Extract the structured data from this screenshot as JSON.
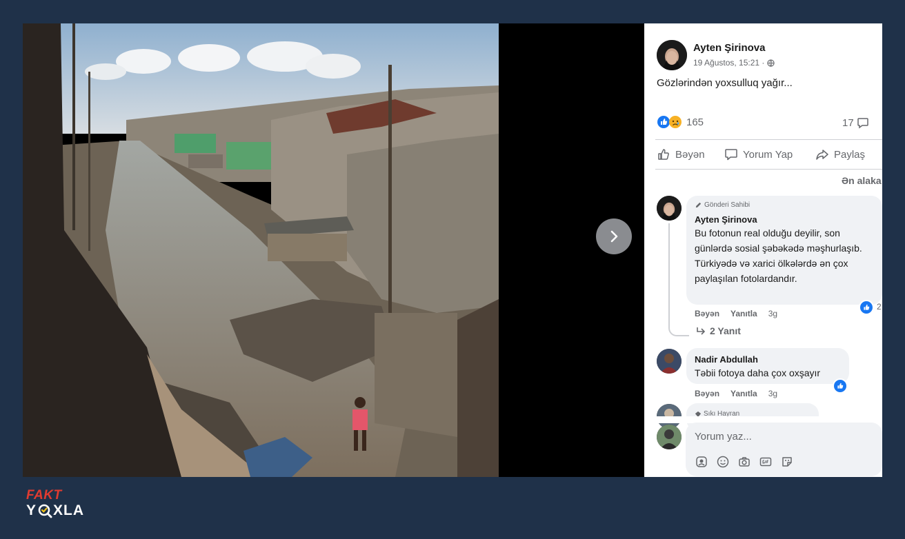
{
  "viewer": {
    "next_icon": "chevron-right-icon"
  },
  "post": {
    "author": "Ayten Şirinova",
    "timestamp": "19 Ağustos, 15:21 ·",
    "privacy_icon": "globe-icon",
    "text": "Gözlərindən yoxsulluq yağır...",
    "reaction_count": "165",
    "comment_count": "17",
    "actions": {
      "like": "Bəyən",
      "comment": "Yorum Yap",
      "share": "Paylaş"
    },
    "sort_label": "Ən alaka"
  },
  "comments": [
    {
      "badge": "Gönderi Sahibi",
      "author": "Ayten Şirinova",
      "text": "Bu fotonun real olduğu deyilir, son günlərdə sosial şəbəkədə məşhurlaşıb. Türkiyədə və xarici ölkələrdə ən çox paylaşılan fotolardandır.",
      "like_label": "Bəyən",
      "reply_label": "Yanıtla",
      "time": "3g",
      "reaction_count": "2",
      "replies_label": "2 Yanıt"
    },
    {
      "author": "Nadir Abdullah",
      "text": "Təbii fotoya daha çox oxşayır",
      "like_label": "Bəyən",
      "reply_label": "Yanıtla",
      "time": "3g"
    },
    {
      "badge": "Sıkı Hayran"
    }
  ],
  "composer": {
    "placeholder": "Yorum yaz..."
  },
  "logo": {
    "line1": "FAKT",
    "line2_pre": "Y",
    "line2_post": "XLA"
  },
  "colors": {
    "background": "#1f3149",
    "facebook_blue": "#1877f2",
    "logo_red": "#e23b30"
  }
}
